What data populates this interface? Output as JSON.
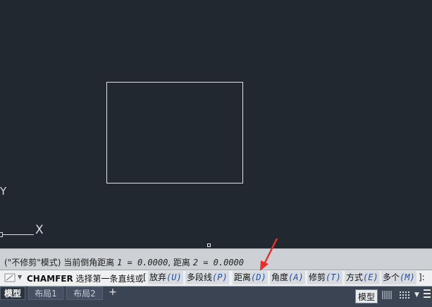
{
  "history": {
    "mode_text": "(\"不修剪\"模式) 当前倒角距离 ",
    "var1": "1 = 0.0000",
    "sep": ", 距离 ",
    "var2": "2 = 0.0000"
  },
  "command": {
    "name": "CHAMFER",
    "prompt": " 选择第一条直线或 ",
    "bracket_open": "[",
    "bracket_close": "]:",
    "options": [
      {
        "label": "放弃",
        "key": "(U)"
      },
      {
        "label": "多段线",
        "key": "(P)"
      },
      {
        "label": "距离",
        "key": "(D)"
      },
      {
        "label": "角度",
        "key": "(A)"
      },
      {
        "label": "修剪",
        "key": "(T)"
      },
      {
        "label": "方式",
        "key": "(E)"
      },
      {
        "label": "多个",
        "key": "(M)"
      }
    ]
  },
  "ucs": {
    "y_label": "Y",
    "x_label": "X"
  },
  "tabs": [
    {
      "label": "模型",
      "active": true
    },
    {
      "label": "布局1",
      "active": false
    },
    {
      "label": "布局2",
      "active": false
    }
  ],
  "tab_add": "+",
  "status": {
    "model_label": "模型",
    "dropdown": "▼"
  },
  "colors": {
    "canvas": "#212830",
    "annotation_arrow": "#e8302a",
    "option_key": "#1f4ea8"
  },
  "icons": [
    "command-line-icon",
    "grid-icon",
    "snap-icon",
    "menu-icon",
    "annotation-arrow-icon"
  ]
}
